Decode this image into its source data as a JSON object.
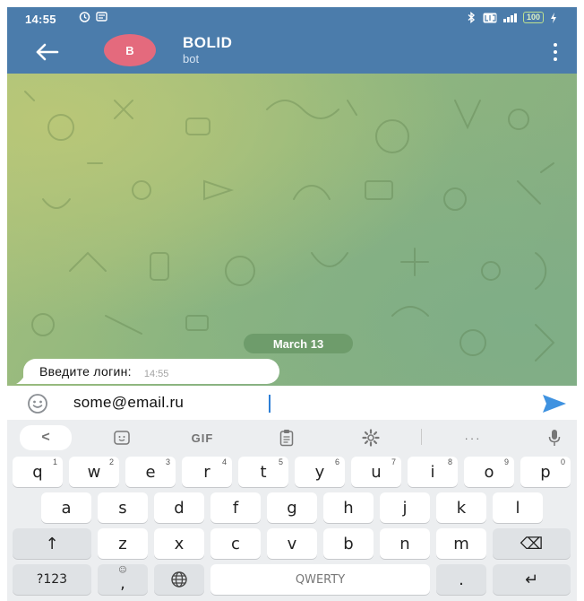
{
  "status_bar": {
    "time": "14:55",
    "battery": "100"
  },
  "header": {
    "avatar_letter": "B",
    "title": "BOLID",
    "subtitle": "bot"
  },
  "chat": {
    "date_separator": "March 13",
    "messages": [
      {
        "text": "Введите логин:",
        "time": "14:55"
      }
    ]
  },
  "input": {
    "value": "some@email.ru"
  },
  "keyboard": {
    "toolbar": {
      "collapse": "<",
      "gif": "GIF",
      "more": "···"
    },
    "rows": [
      [
        {
          "key": "q",
          "hint": "1"
        },
        {
          "key": "w",
          "hint": "2"
        },
        {
          "key": "e",
          "hint": "3"
        },
        {
          "key": "r",
          "hint": "4"
        },
        {
          "key": "t",
          "hint": "5"
        },
        {
          "key": "y",
          "hint": "6"
        },
        {
          "key": "u",
          "hint": "7"
        },
        {
          "key": "i",
          "hint": "8"
        },
        {
          "key": "o",
          "hint": "9"
        },
        {
          "key": "p",
          "hint": "0"
        }
      ],
      [
        {
          "key": "a"
        },
        {
          "key": "s"
        },
        {
          "key": "d"
        },
        {
          "key": "f"
        },
        {
          "key": "g"
        },
        {
          "key": "h"
        },
        {
          "key": "j"
        },
        {
          "key": "k"
        },
        {
          "key": "l"
        }
      ],
      [
        {
          "key": "↑"
        },
        {
          "key": "z"
        },
        {
          "key": "x"
        },
        {
          "key": "c"
        },
        {
          "key": "v"
        },
        {
          "key": "b"
        },
        {
          "key": "n"
        },
        {
          "key": "m"
        },
        {
          "key": "⌫"
        }
      ]
    ],
    "bottom_row": {
      "symbols": "?123",
      "comma": ",",
      "space": "QWERTY",
      "period": ".",
      "enter": "↵"
    }
  },
  "colors": {
    "header": "#4b7cab",
    "avatar": "#e46a7d",
    "date_pill": "#6e9c6b",
    "send": "#3f92e0",
    "keyboard_bg": "#eceef0"
  }
}
